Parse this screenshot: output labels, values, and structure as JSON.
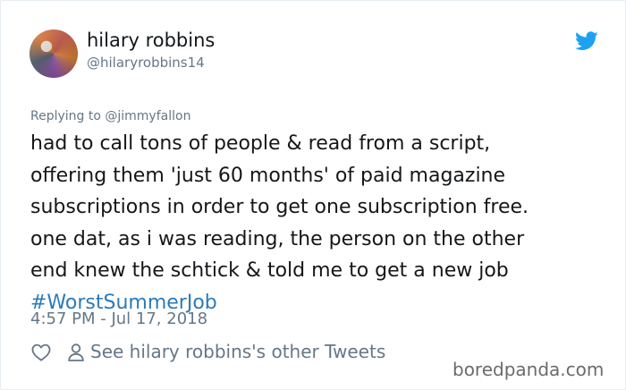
{
  "tweet": {
    "display_name": "hilary robbins",
    "handle": "@hilaryrobbins14",
    "replying_to": "Replying to @jimmyfallon",
    "text_lines": [
      "had to call tons of people & read from a script,",
      "offering them 'just 60 months' of paid magazine",
      "subscriptions in order to get one subscription free.",
      "one dat, as i was reading, the person on the other",
      "end knew the schtick & told me to get a new job"
    ],
    "hashtag": "#WorstSummerJob",
    "timestamp": "4:57 PM - Jul 17, 2018",
    "other_tweets_link": "See hilary robbins's other Tweets"
  },
  "watermark": "boredpanda.com",
  "colors": {
    "text": "#14171a",
    "muted": "#657786",
    "link": "#2b7bb9",
    "twitter_blue": "#1da1f2"
  },
  "icons": [
    "twitter-bird-icon",
    "heart-icon",
    "person-icon"
  ]
}
